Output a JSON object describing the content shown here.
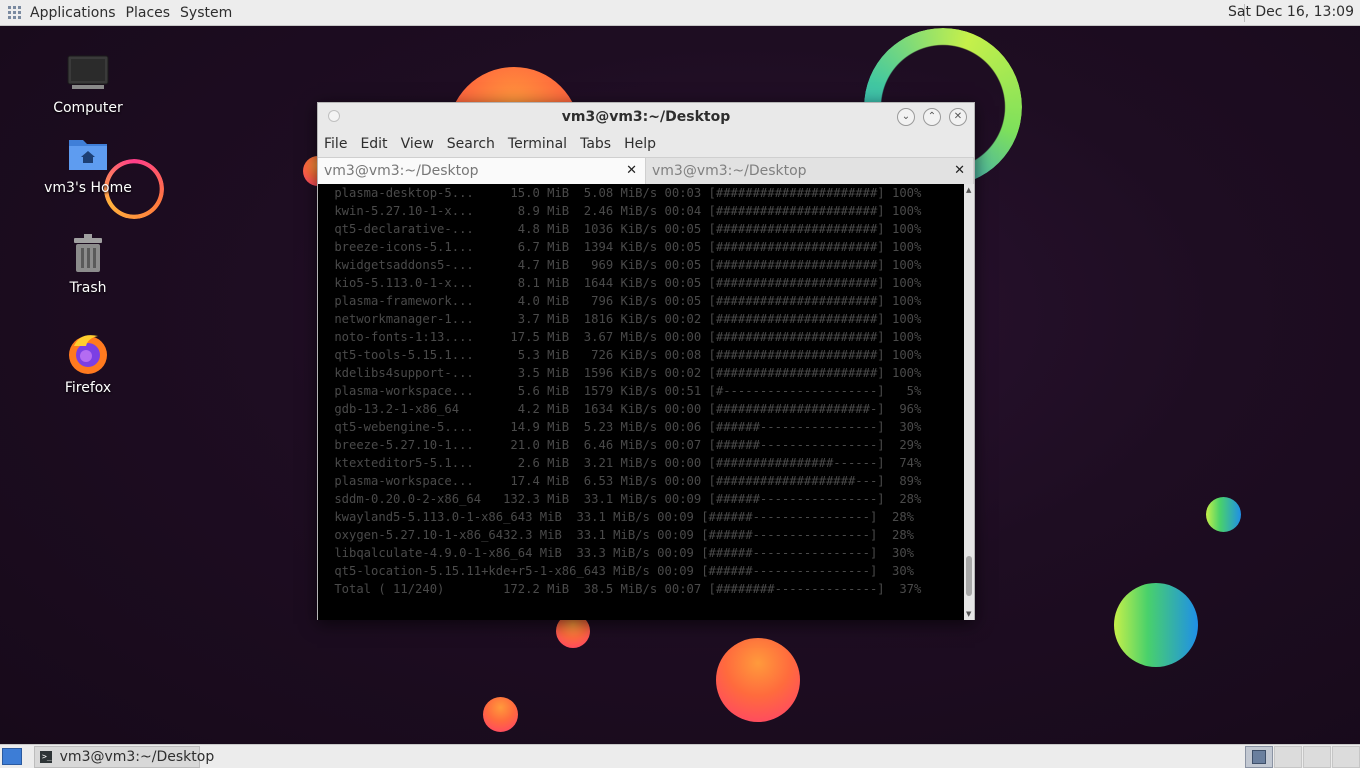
{
  "top_panel": {
    "menus": [
      "Applications",
      "Places",
      "System"
    ],
    "clock": "Sat Dec 16, 13:09"
  },
  "desktop_icons": [
    {
      "label": "Computer",
      "icon": "computer-icon"
    },
    {
      "label": "vm3's Home",
      "icon": "home-folder-icon"
    },
    {
      "label": "Trash",
      "icon": "trash-icon"
    },
    {
      "label": "Firefox",
      "icon": "firefox-icon"
    }
  ],
  "terminal": {
    "title": "vm3@vm3:~/Desktop",
    "menu": [
      "File",
      "Edit",
      "View",
      "Search",
      "Terminal",
      "Tabs",
      "Help"
    ],
    "tabs": [
      {
        "label": "vm3@vm3:~/Desktop",
        "active": true
      },
      {
        "label": "vm3@vm3:~/Desktop",
        "active": false
      }
    ],
    "lines": [
      " plasma-desktop-5...     15.0 MiB  5.08 MiB/s 00:03 [######################] 100%",
      " kwin-5.27.10-1-x...      8.9 MiB  2.46 MiB/s 00:04 [######################] 100%",
      " qt5-declarative-...      4.8 MiB  1036 KiB/s 00:05 [######################] 100%",
      " breeze-icons-5.1...      6.7 MiB  1394 KiB/s 00:05 [######################] 100%",
      " kwidgetsaddons5-...      4.7 MiB   969 KiB/s 00:05 [######################] 100%",
      " kio5-5.113.0-1-x...      8.1 MiB  1644 KiB/s 00:05 [######################] 100%",
      " plasma-framework...      4.0 MiB   796 KiB/s 00:05 [######################] 100%",
      " networkmanager-1...      3.7 MiB  1816 KiB/s 00:02 [######################] 100%",
      " noto-fonts-1:13....     17.5 MiB  3.67 MiB/s 00:00 [######################] 100%",
      " qt5-tools-5.15.1...      5.3 MiB   726 KiB/s 00:08 [######################] 100%",
      " kdelibs4support-...      3.5 MiB  1596 KiB/s 00:02 [######################] 100%",
      " plasma-workspace...      5.6 MiB  1579 KiB/s 00:51 [#---------------------]   5%",
      " gdb-13.2-1-x86_64        4.2 MiB  1634 KiB/s 00:00 [#####################-]  96%",
      " qt5-webengine-5....     14.9 MiB  5.23 MiB/s 00:06 [######----------------]  30%",
      " breeze-5.27.10-1...     21.0 MiB  6.46 MiB/s 00:07 [######----------------]  29%",
      " ktexteditor5-5.1...      2.6 MiB  3.21 MiB/s 00:00 [################------]  74%",
      " plasma-workspace...     17.4 MiB  6.53 MiB/s 00:00 [###################---]  89%",
      " sddm-0.20.0-2-x86_64   132.3 MiB  33.1 MiB/s 00:09 [######----------------]  28%",
      " kwayland5-5.113.0-1-x86_643 MiB  33.1 MiB/s 00:09 [######----------------]  28%",
      " oxygen-5.27.10-1-x86_6432.3 MiB  33.1 MiB/s 00:09 [######----------------]  28%",
      " libqalculate-4.9.0-1-x86_64 MiB  33.3 MiB/s 00:09 [######----------------]  30%",
      " qt5-location-5.15.11+kde+r5-1-x86_643 MiB/s 00:09 [######----------------]  30%",
      " Total ( 11/240)        172.2 MiB  38.5 MiB/s 00:07 [########--------------]  37%"
    ]
  },
  "taskbar": {
    "task_label": "vm3@vm3:~/Desktop",
    "workspaces": 4
  },
  "colors": {
    "desktop_bg": "#1e0d22",
    "panel_bg": "#ededed",
    "terminal_bg": "#000000",
    "terminal_fg": "#4a4a4a"
  }
}
